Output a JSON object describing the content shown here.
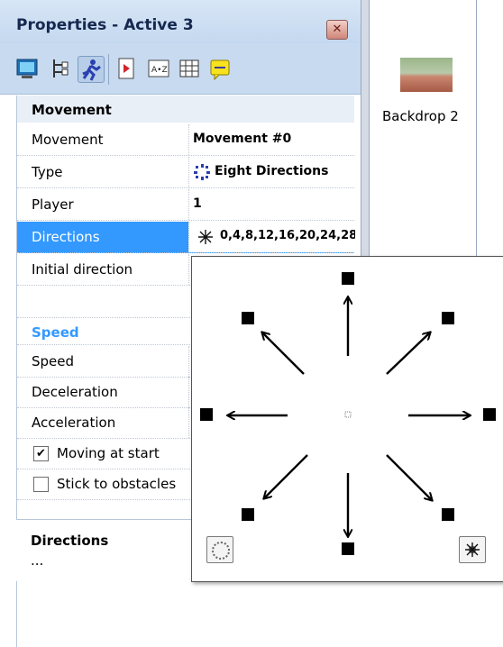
{
  "panel": {
    "title": "Properties - Active 3",
    "close_glyph": "✕",
    "toolbar_icons": [
      "display-icon",
      "events-icon",
      "movement-icon",
      "runtime-icon",
      "values-icon",
      "grid-icon",
      "about-icon"
    ]
  },
  "grid": {
    "sections": {
      "movement": "Movement",
      "speed": "Speed"
    },
    "rows": {
      "movement": {
        "label": "Movement",
        "value": "Movement #0"
      },
      "type": {
        "label": "Type",
        "value": "Eight Directions"
      },
      "player": {
        "label": "Player",
        "value": "1"
      },
      "directions": {
        "label": "Directions",
        "value": "0,4,8,12,16,20,24,28"
      },
      "initial_direction": {
        "label": "Initial direction",
        "value": ""
      },
      "speed": {
        "label": "Speed",
        "value": ""
      },
      "deceleration": {
        "label": "Deceleration",
        "value": ""
      },
      "acceleration": {
        "label": "Acceleration",
        "value": ""
      }
    },
    "checks": {
      "moving_at_start": {
        "label": "Moving at start",
        "checked": true
      },
      "stick_to_obstacles": {
        "label": "Stick to obstacles",
        "checked": false
      }
    }
  },
  "help": {
    "title": "Directions",
    "text": "..."
  },
  "frame": {
    "backdrop_label": "Backdrop 2"
  },
  "colors": {
    "accent": "#3399ff",
    "speed_header": "#3399ff"
  }
}
